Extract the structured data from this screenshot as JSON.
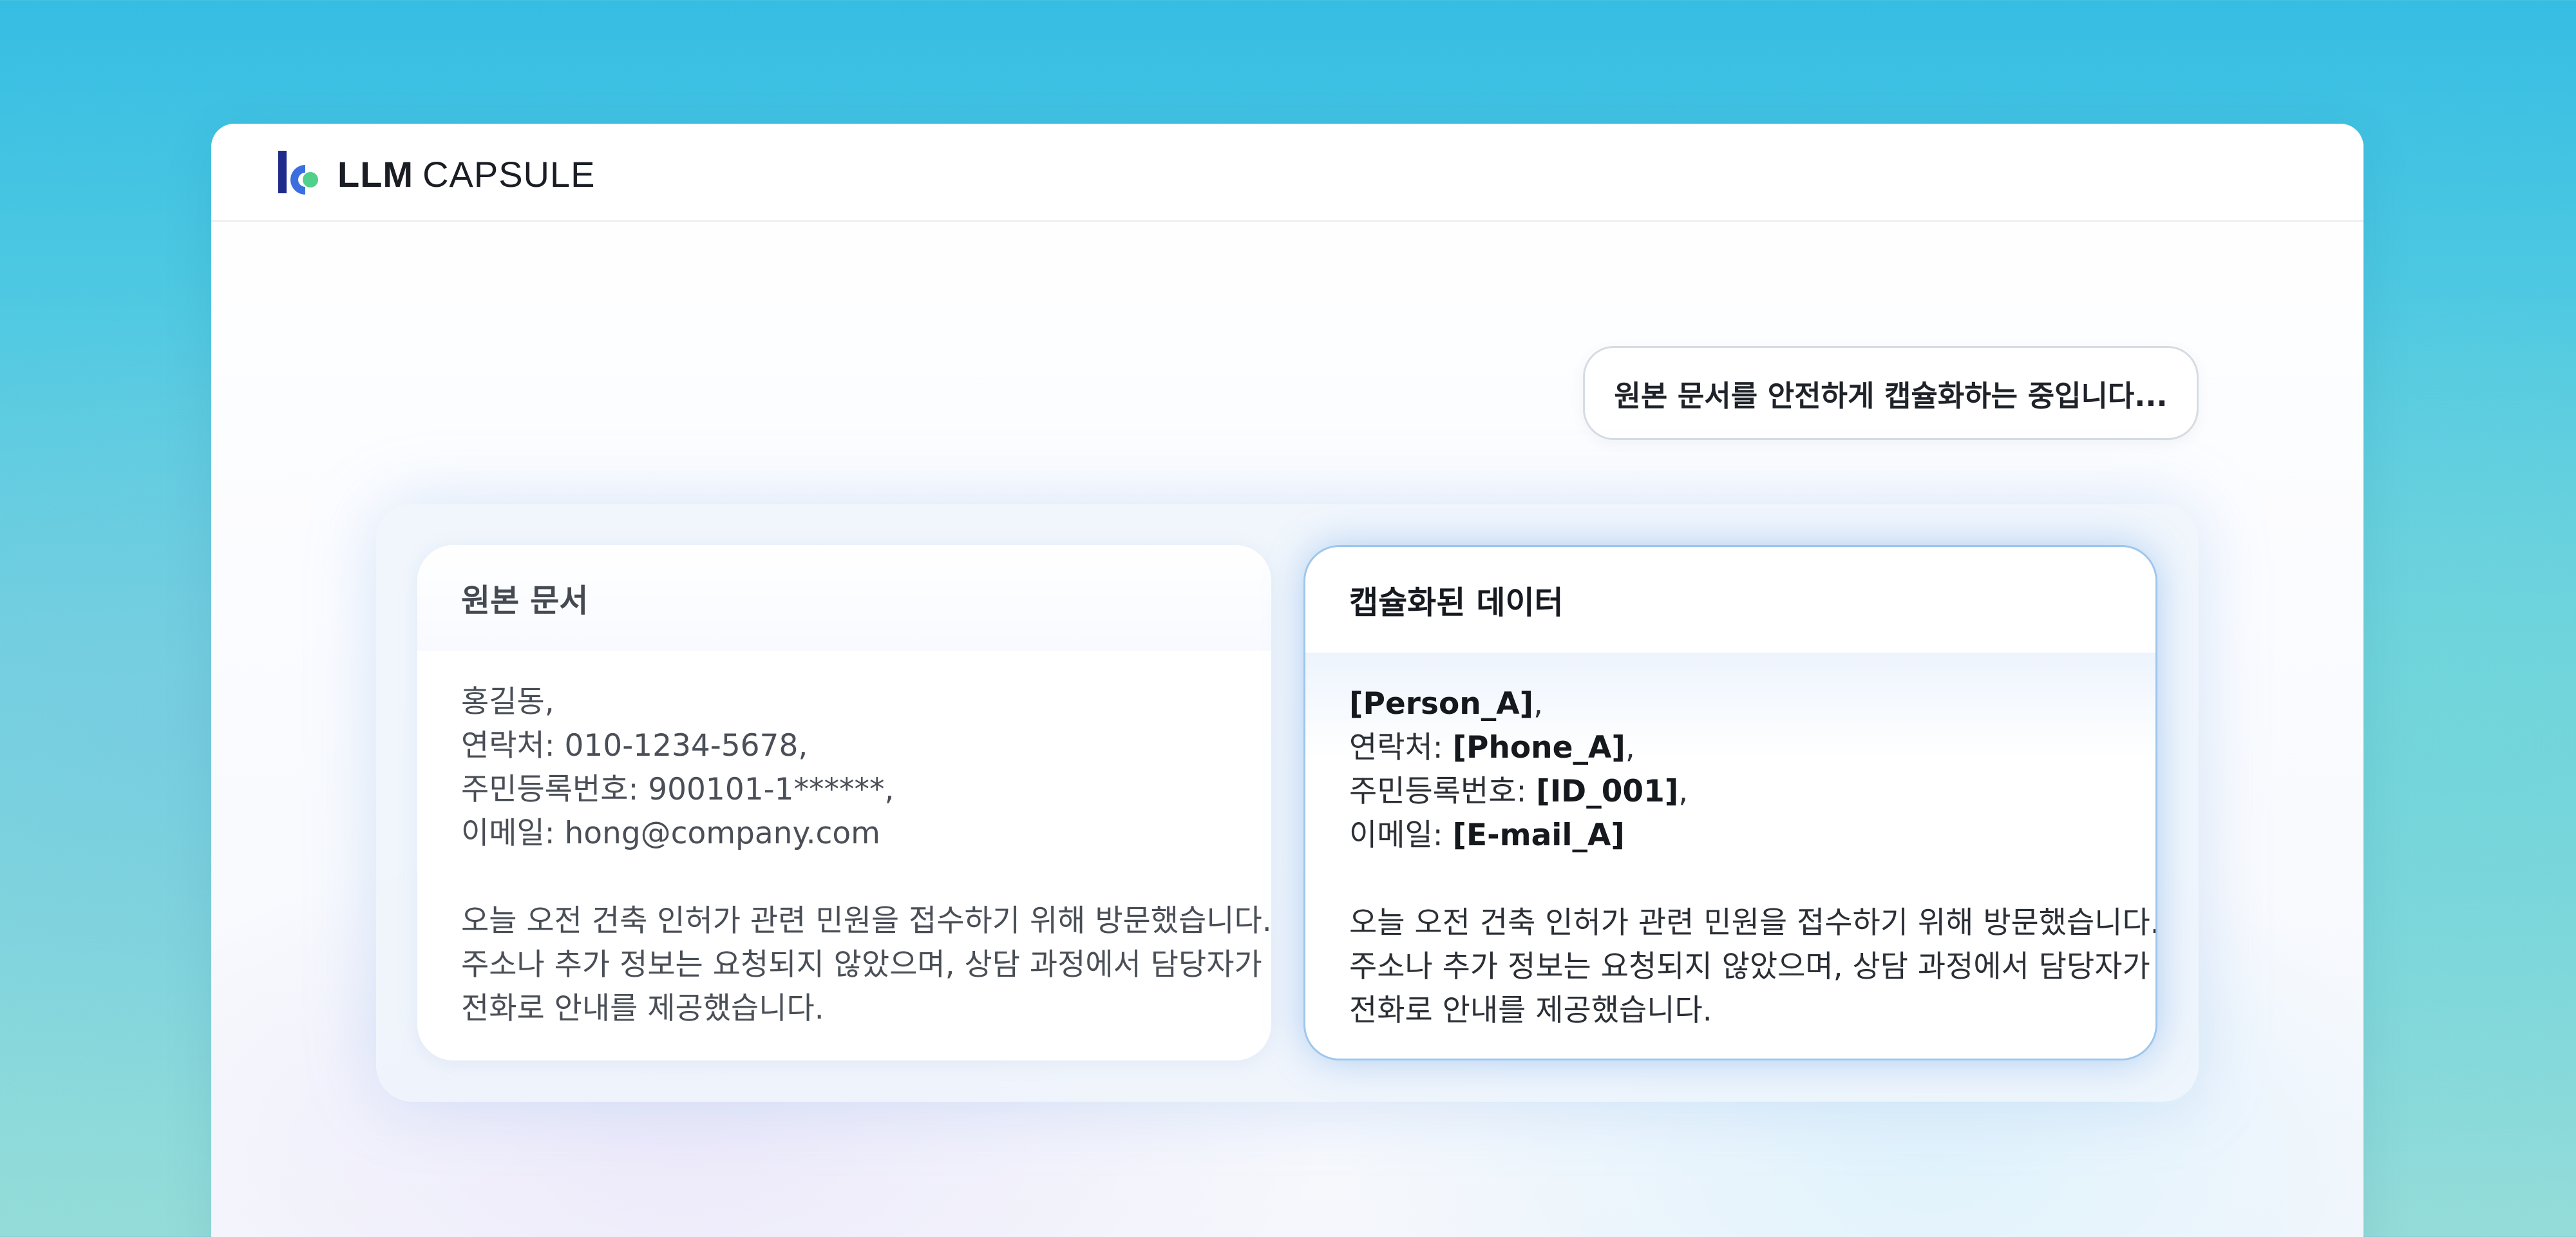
{
  "header": {
    "logo_bold": "LLM",
    "logo_light": "CAPSULE"
  },
  "status": {
    "message": "원본 문서를 안전하게 캡슐화하는 중입니다..."
  },
  "original_card": {
    "title": "원본 문서",
    "name": "홍길동,",
    "contact_label": "연락처: ",
    "contact_value": "010-1234-5678,",
    "id_label": "주민등록번호: ",
    "id_value": "900101-1******,",
    "email_label": "이메일: ",
    "email_value": "hong@company.com",
    "paragraph_lines": [
      "오늘 오전 건축 인허가 관련 민원을 접수하기 위해 방문했습니다.",
      "주소나 추가 정보는 요청되지 않았으며, 상담 과정에서 담당자가",
      "전화로 안내를 제공했습니다."
    ]
  },
  "capsuled_card": {
    "title": "캡슐화된 데이터",
    "name_tag": "[Person_A]",
    "name_suffix": ",",
    "contact_label": "연락처: ",
    "contact_tag": "[Phone_A]",
    "contact_suffix": ",",
    "id_label": "주민등록번호: ",
    "id_tag": "[ID_001]",
    "id_suffix": ",",
    "email_label": "이메일: ",
    "email_tag": "[E-mail_A]",
    "paragraph_lines": [
      "오늘 오전 건축 인허가 관련 민원을 접수하기 위해 방문했습니다.",
      "주소나 추가 정보는 요청되지 않았으며, 상담 과정에서 담당자가",
      "전화로 안내를 제공했습니다."
    ]
  },
  "colors": {
    "logo_navy": "#1f2a8a",
    "logo_blue": "#3b6fe0",
    "logo_green": "#4fd18b",
    "capsuled_border": "#9ec6ec"
  }
}
